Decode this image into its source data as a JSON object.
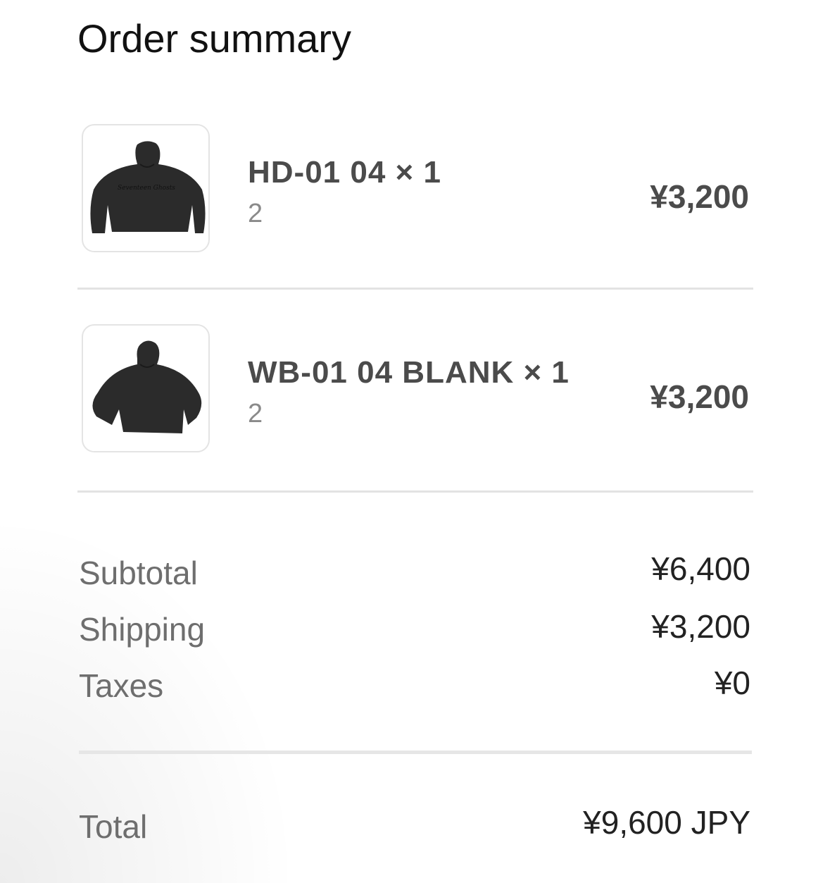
{
  "summary": {
    "title": "Order summary"
  },
  "items": [
    {
      "name": "HD-01 04 × 1",
      "variant": "2",
      "price": "¥3,200",
      "image_icon": "hoodie-printed-icon",
      "image_text": "Seventeen Ghosts"
    },
    {
      "name": "WB-01 04 BLANK × 1",
      "variant": "2",
      "price": "¥3,200",
      "image_icon": "hoodie-blank-icon"
    }
  ],
  "totals": {
    "subtotal_label": "Subtotal",
    "subtotal_value": "¥6,400",
    "shipping_label": "Shipping",
    "shipping_value": "¥3,200",
    "taxes_label": "Taxes",
    "taxes_value": "¥0",
    "total_label": "Total",
    "total_value": "¥9,600 JPY"
  },
  "colors": {
    "text_primary": "#111111",
    "text_item": "#4b4b4b",
    "text_muted": "#8a8a8a",
    "divider": "#e3e3e3",
    "garment": "#2b2b2b"
  }
}
